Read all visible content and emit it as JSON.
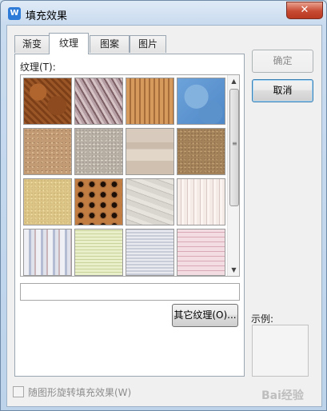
{
  "window": {
    "title": "填充效果",
    "app_icon_glyph": "W",
    "close_glyph": "✕"
  },
  "tabs": [
    {
      "label": "渐变",
      "active": false
    },
    {
      "label": "纹理",
      "active": true
    },
    {
      "label": "图案",
      "active": false
    },
    {
      "label": "图片",
      "active": false
    }
  ],
  "texture_panel": {
    "label": "纹理(T):",
    "selected_texture_name": "",
    "textures": [
      "brown-leather",
      "purple-fossil",
      "woven-burlap",
      "blue-tissue",
      "brown-sand",
      "gray-granite",
      "beige-paper",
      "brown-cork",
      "yellow-sand",
      "leopard-fur",
      "newsprint-doodle",
      "white-stripes",
      "blue-stripes",
      "green-check",
      "gray-weave",
      "pink-check"
    ],
    "other_textures_button": "其它纹理(O)..."
  },
  "buttons": {
    "ok": "确定",
    "cancel": "取消"
  },
  "preview": {
    "label": "示例:"
  },
  "rotate_option": {
    "label": "随图形旋转填充效果(W)",
    "checked": false,
    "enabled": false
  },
  "watermark": {
    "text": "Bai经验"
  }
}
